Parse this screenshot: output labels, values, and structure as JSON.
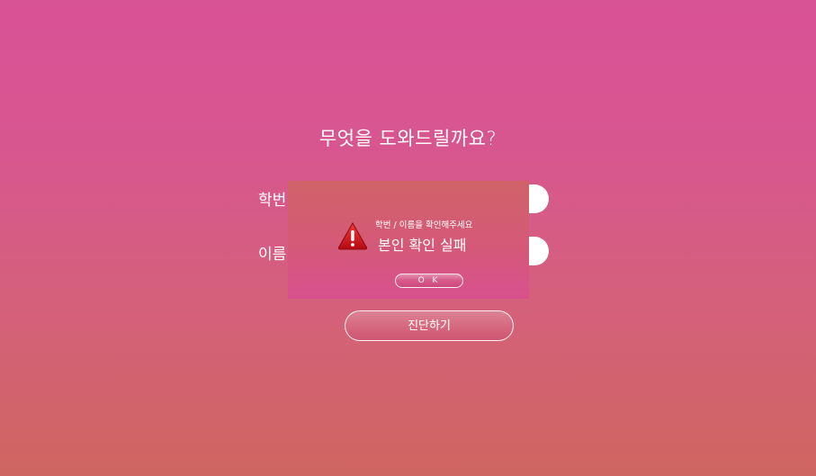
{
  "page": {
    "title": "무엇을 도와드릴까요?",
    "form": {
      "student_id_label": "학번",
      "name_label": "이름"
    },
    "diagnose_button": "진단하기"
  },
  "dialog": {
    "icon": "warning-icon",
    "subtitle": "학번 / 이름을 확인해주세요",
    "message": "본인 확인 실패",
    "ok_button": "O K"
  },
  "colors": {
    "background_top": "#d85296",
    "background_bottom": "#cf6560",
    "warning_icon": "#d9141c"
  }
}
